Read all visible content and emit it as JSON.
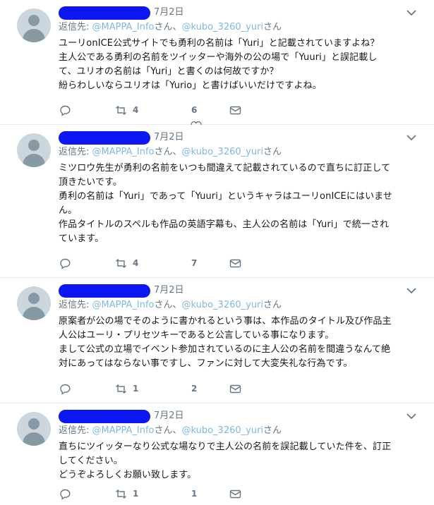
{
  "tweets": [
    {
      "date": "7月2日",
      "reply_label": "返信先: ",
      "mention1": "@MAPPA_Info",
      "san1": "さん、",
      "mention2": "@kubo_3260_yuri",
      "san2": "さん",
      "text": "ユーリonICE公式サイトでも勇利の名前は「Yuri」と記載されていますよね？\n主人公である勇利の名前をツイッターや海外の公の場で「Yuuri」と誤記載し\nて、ユリオの名前は「Yuri」と書くのは何故ですか？\n紛らわしいならユリオは「Yurio」と書けばいいだけですよね。",
      "retweets": "4",
      "likes": "6"
    },
    {
      "date": "7月2日",
      "reply_label": "返信先: ",
      "mention1": "@MAPPA_Info",
      "san1": "さん、",
      "mention2": "@kubo_3260_yuri",
      "san2": "さん",
      "text": "ミツロウ先生が勇利の名前をいつも間違えて記載されているので直ちに訂正して\n頂きたいです。\n勇利の名前は「Yuri」であって「Yuuri」というキャラはユーリonICEにはいませ\nん。\n作品タイトルのスペルも作品の英語字幕も、主人公の名前は「Yuri」で統一され\nています。",
      "retweets": "4",
      "likes": "7"
    },
    {
      "date": "7月2日",
      "reply_label": "返信先: ",
      "mention1": "@MAPPA_Info",
      "san1": "さん、",
      "mention2": "@kubo_3260_yuri",
      "san2": "さん",
      "text": "原案者が公の場でそのように書かれるという事は、本作品のタイトル及び作品主\n人公はユーリ・プリセツキーであると公言している事になります。\nまして公式の立場でイベント参加されているのに主人公の名前を間違うなんて絶\n対にあってはならない事ですし、ファンに対して大変失礼な行為です。",
      "retweets": "1",
      "likes": "2"
    },
    {
      "date": "7月2日",
      "reply_label": "返信先: ",
      "mention1": "@MAPPA_Info",
      "san1": "さん、",
      "mention2": "@kubo_3260_yuri",
      "san2": "さん",
      "text": "直ちにツイッターなり公式な場なりで主人公の名前を誤記載していた件を、訂正\nしてください。\nどうぞよろしくお願い致します。",
      "retweets": "1",
      "likes": "1"
    }
  ],
  "colors": {
    "redaction": "#0b16f2",
    "mention": "#7fb8e0",
    "meta": "#657786",
    "text": "#14171a"
  }
}
